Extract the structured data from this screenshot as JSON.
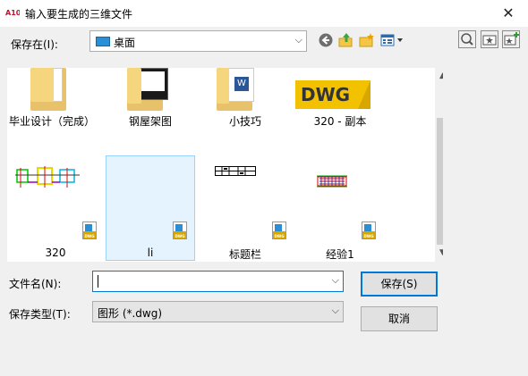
{
  "window": {
    "title": "输入要生成的三维文件",
    "close_glyph": "✕",
    "app_icon_text": "A10"
  },
  "toolbar": {
    "lookin_label": "保存在(I):",
    "lookin_value": "桌面",
    "icons": [
      "back-icon",
      "up-folder-icon",
      "new-folder-icon",
      "views-menu-icon",
      "search-web-icon",
      "favorites-icon",
      "add-favorite-icon"
    ]
  },
  "files": [
    {
      "name": "毕业设计（完成）",
      "kind": "folder"
    },
    {
      "name": "钢屋架图",
      "kind": "folder"
    },
    {
      "name": "小技巧",
      "kind": "folder"
    },
    {
      "name": "320 - 副本",
      "kind": "dwg-large"
    },
    {
      "name": "320",
      "kind": "dwg"
    },
    {
      "name": "li",
      "kind": "dwg",
      "selected": true
    },
    {
      "name": "标题栏",
      "kind": "dwg"
    },
    {
      "name": "经验1",
      "kind": "dwg"
    }
  ],
  "badge_text": "DWG",
  "form": {
    "filename_label": "文件名(N):",
    "filename_value": "",
    "filetype_label": "保存类型(T):",
    "filetype_value": "图形 (*.dwg)"
  },
  "buttons": {
    "save": "保存(S)",
    "cancel": "取消"
  },
  "colors": {
    "accent": "#0078d7",
    "folder": "#f6d57f",
    "dwg_gold": "#d9a600",
    "selection": "#e5f3ff"
  }
}
